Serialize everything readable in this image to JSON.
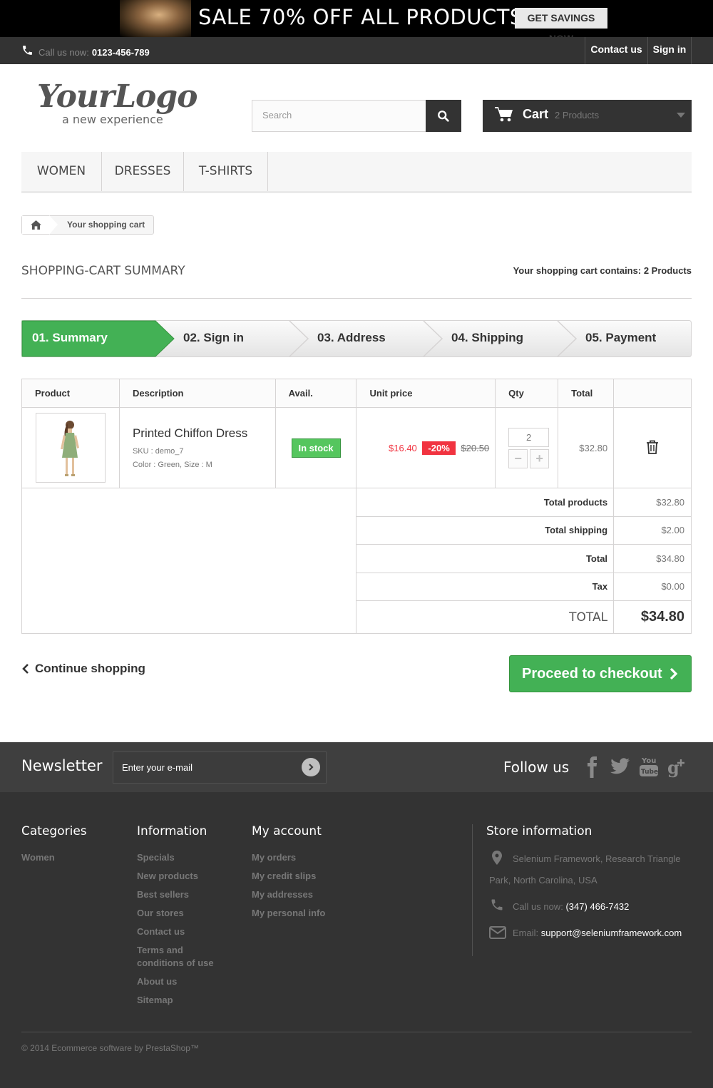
{
  "banner": {
    "text": "SALE 70% OFF ALL PRODUCTS",
    "button": "GET SAVINGS NOW"
  },
  "topbar": {
    "phone_label": "Call us now:",
    "phone": "0123-456-789",
    "contact": "Contact us",
    "signin": "Sign in"
  },
  "logo": {
    "name": "YourLogo",
    "tagline": "a new experience"
  },
  "search": {
    "placeholder": "Search"
  },
  "cart": {
    "label": "Cart",
    "count": "2 Products"
  },
  "menu": [
    "WOMEN",
    "DRESSES",
    "T-SHIRTS"
  ],
  "breadcrumb": {
    "current": "Your shopping cart"
  },
  "page": {
    "title": "SHOPPING-CART SUMMARY",
    "count_label": "Your shopping cart contains:",
    "count": "2 Products"
  },
  "steps": [
    "01. Summary",
    "02. Sign in",
    "03. Address",
    "04. Shipping",
    "05. Payment"
  ],
  "table": {
    "headers": [
      "Product",
      "Description",
      "Avail.",
      "Unit price",
      "Qty",
      "Total"
    ],
    "item": {
      "name": "Printed Chiffon Dress",
      "sku": "SKU : demo_7",
      "attrs": "Color : Green, Size : M",
      "availability": "In stock",
      "price": "$16.40",
      "discount": "-20%",
      "old_price": "$20.50",
      "qty": "2",
      "total": "$32.80"
    },
    "summary": [
      {
        "label": "Total products",
        "value": "$32.80"
      },
      {
        "label": "Total shipping",
        "value": "$2.00"
      },
      {
        "label": "Total",
        "value": "$34.80"
      },
      {
        "label": "Tax",
        "value": "$0.00"
      }
    ],
    "grand_label": "TOTAL",
    "grand_value": "$34.80"
  },
  "actions": {
    "continue": "Continue shopping",
    "checkout": "Proceed to checkout"
  },
  "footer": {
    "newsletter_title": "Newsletter",
    "newsletter_placeholder": "Enter your e-mail",
    "follow": "Follow us",
    "categories": {
      "title": "Categories",
      "items": [
        "Women"
      ]
    },
    "information": {
      "title": "Information",
      "items": [
        "Specials",
        "New products",
        "Best sellers",
        "Our stores",
        "Contact us",
        "Terms and conditions of use",
        "About us",
        "Sitemap"
      ]
    },
    "account": {
      "title": "My account",
      "items": [
        "My orders",
        "My credit slips",
        "My addresses",
        "My personal info"
      ]
    },
    "store": {
      "title": "Store information",
      "address": "Selenium Framework, Research Triangle Park, North Carolina, USA",
      "phone_label": "Call us now:",
      "phone": "(347) 466-7432",
      "email_label": "Email:",
      "email": "support@seleniumframework.com"
    },
    "copyright": "© 2014 Ecommerce software by PrestaShop™"
  },
  "colors": {
    "accent": "#43b155",
    "dark": "#333333",
    "discount": "#f13340"
  }
}
